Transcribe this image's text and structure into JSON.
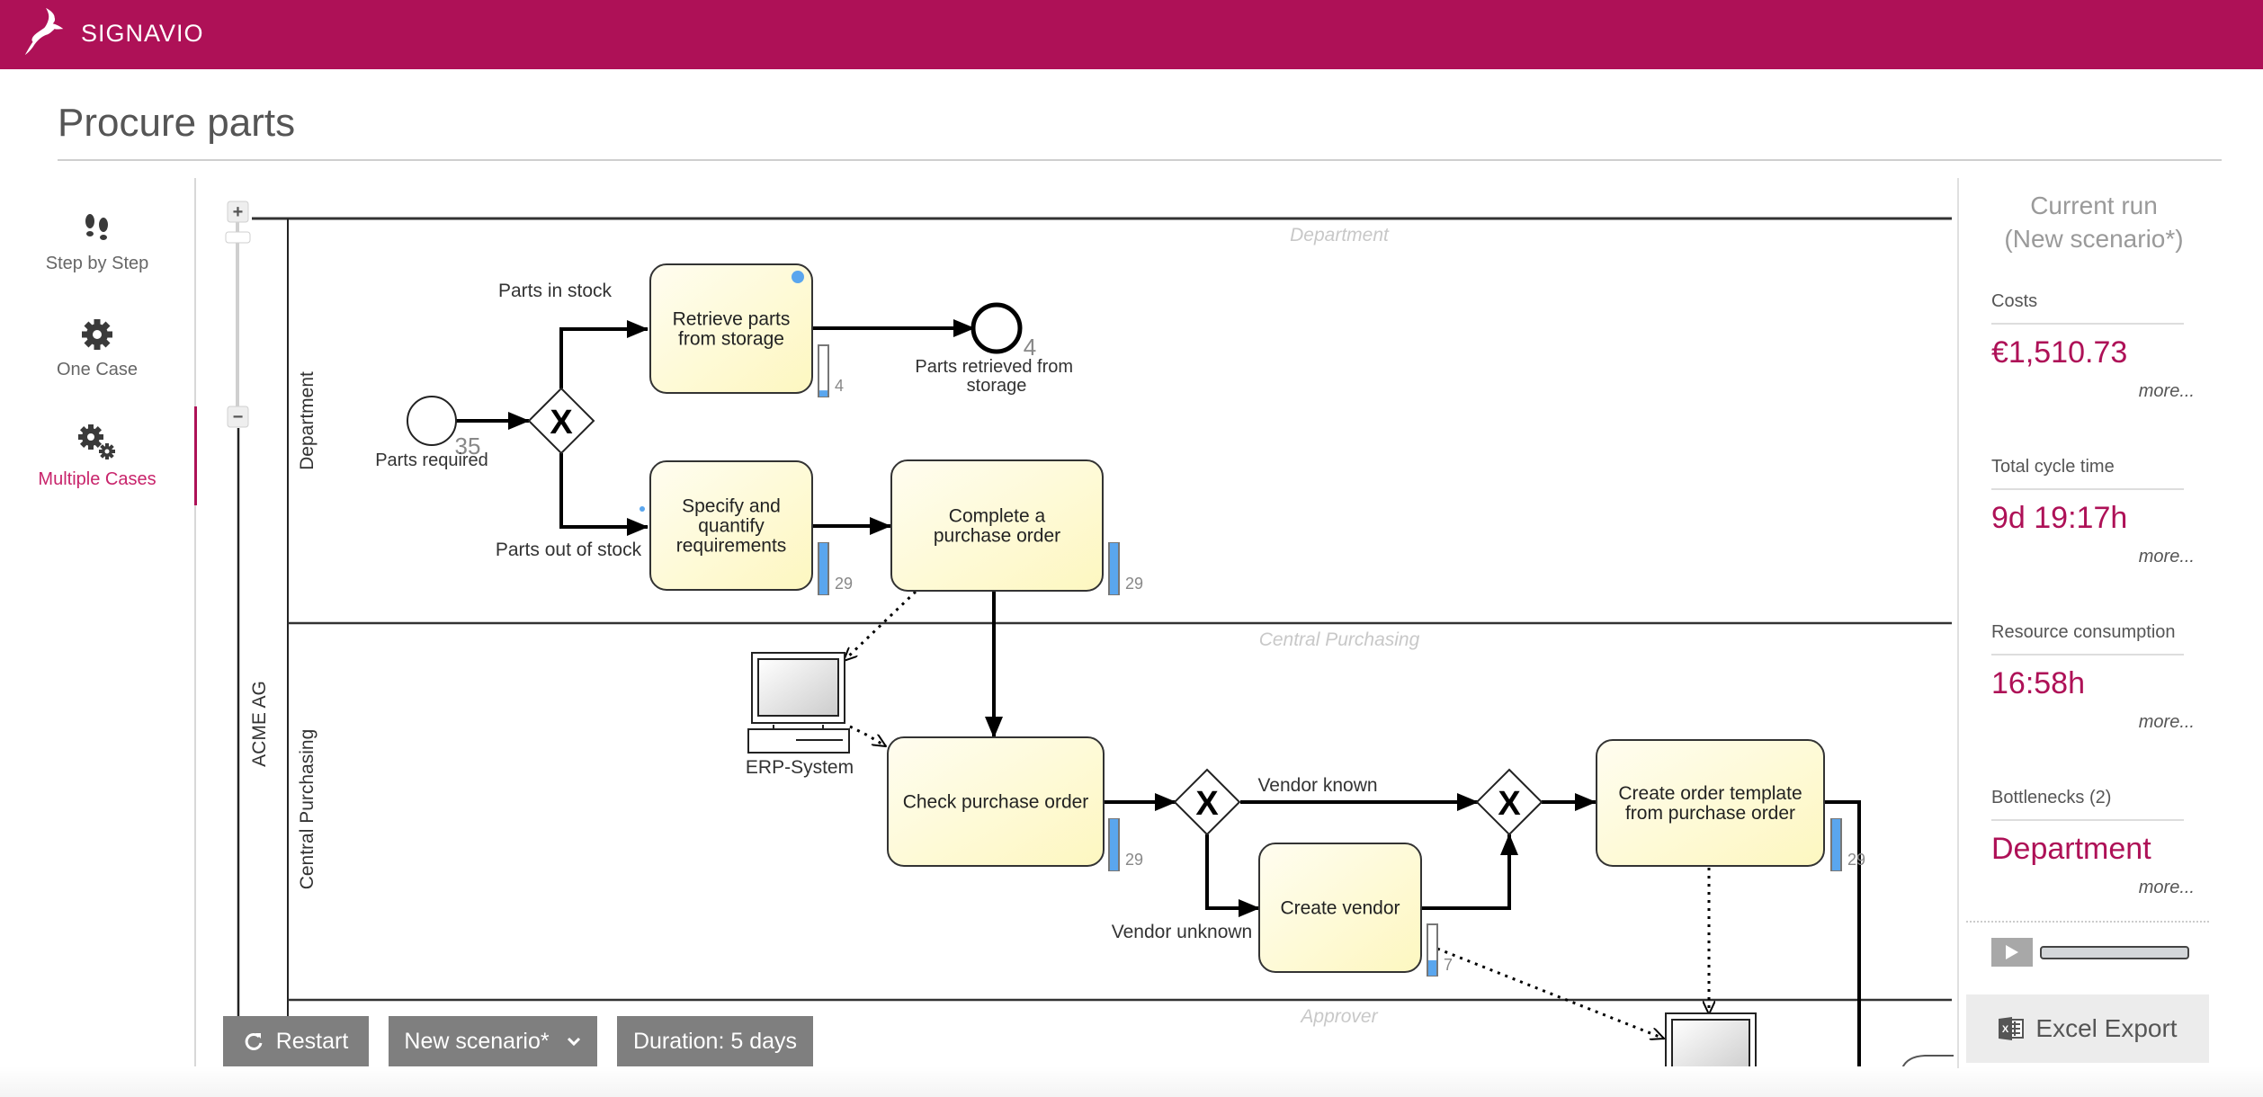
{
  "app": {
    "brand": "SIGNAVIO",
    "brand_color": "#ae1157",
    "accent_color": "#c8246b"
  },
  "page": {
    "title": "Procure parts"
  },
  "sidebar": {
    "items": [
      {
        "label": "Step by Step",
        "icon": "footsteps-icon",
        "active": false
      },
      {
        "label": "One Case",
        "icon": "gear-icon",
        "active": false
      },
      {
        "label": "Multiple Cases",
        "icon": "gears-icon",
        "active": true
      }
    ]
  },
  "diagram": {
    "zoom_controls": {
      "zoom_in": "+",
      "zoom_out": "−"
    },
    "pool": {
      "label": "ACME AG"
    },
    "lanes": [
      {
        "label": "Department",
        "header": "Department"
      },
      {
        "label": "Central Purchasing",
        "header": "Central Purchasing"
      },
      {
        "label": "Approver",
        "header": "Approver"
      }
    ],
    "events": [
      {
        "id": "start",
        "label": "Parts required",
        "count": "35",
        "type": "start"
      },
      {
        "id": "end1",
        "label": "Parts retrieved from storage",
        "count": "4",
        "type": "end"
      }
    ],
    "tasks": [
      {
        "id": "t1",
        "label": "Retrieve parts from storage",
        "count": "4",
        "load": 0.12
      },
      {
        "id": "t2",
        "label": "Specify and quantify requirements",
        "count": "29",
        "load": 1.0
      },
      {
        "id": "t3",
        "label": "Complete a purchase order",
        "count": "29",
        "load": 1.0
      },
      {
        "id": "t4",
        "label": "Check purchase order",
        "count": "29",
        "load": 1.0
      },
      {
        "id": "t5",
        "label": "Create vendor",
        "count": "7",
        "load": 0.3
      },
      {
        "id": "t6",
        "label": "Create order template from purchase order",
        "count": "29",
        "load": 1.0
      }
    ],
    "gateways": [
      {
        "id": "g1",
        "symbol": "X"
      },
      {
        "id": "g2",
        "symbol": "X"
      },
      {
        "id": "g3",
        "symbol": "X"
      }
    ],
    "flow_labels": {
      "in_stock": "Parts in stock",
      "out_of_stock": "Parts out of stock",
      "vendor_known": "Vendor known",
      "vendor_unknown": "Vendor unknown"
    },
    "data_objects": [
      {
        "id": "erp",
        "label": "ERP-System",
        "icon": "computer-icon"
      }
    ]
  },
  "toolbar": {
    "restart_label": "Restart",
    "scenario_label": "New scenario*",
    "duration_label": "Duration: 5 days"
  },
  "results": {
    "title_line1": "Current run",
    "title_line2": "(New scenario*)",
    "metrics": [
      {
        "label": "Costs",
        "value": "€1,510.73",
        "more": "more..."
      },
      {
        "label": "Total cycle time",
        "value": "9d 19:17h",
        "more": "more..."
      },
      {
        "label": "Resource consumption",
        "value": "16:58h",
        "more": "more..."
      },
      {
        "label": "Bottlenecks (2)",
        "value": "Department",
        "more": "more..."
      }
    ],
    "playback_progress": 0,
    "export_label": "Excel Export"
  }
}
